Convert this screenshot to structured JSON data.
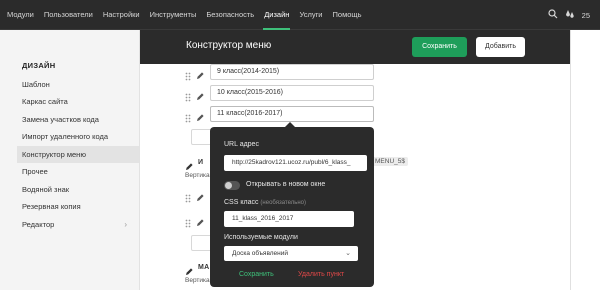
{
  "nav": {
    "items": [
      "Модули",
      "Пользователи",
      "Настройки",
      "Инструменты",
      "Безопасность",
      "Дизайн",
      "Услуги",
      "Помощь"
    ],
    "active": "Дизайн",
    "notification_count": "25"
  },
  "sidebar": {
    "section_title": "ДИЗАЙН",
    "items": [
      {
        "label": "Шаблон"
      },
      {
        "label": "Каркас сайта"
      },
      {
        "label": "Замена участков кода"
      },
      {
        "label": "Импорт удаленного кода"
      },
      {
        "label": "Конструктор меню"
      },
      {
        "label": "Прочее"
      },
      {
        "label": "Водяной знак"
      },
      {
        "label": "Резервная копия"
      },
      {
        "label": "Редактор",
        "arrow": "›"
      }
    ],
    "active": "Конструктор меню"
  },
  "header": {
    "title": "Конструктор меню",
    "save_label": "Сохранить",
    "add_label": "Добавить"
  },
  "menu_rows": [
    {
      "value": "9  класс(2014-2015)"
    },
    {
      "value": "10 класс(2015-2016)"
    },
    {
      "value": "11 класс(2016-2017)"
    }
  ],
  "block2": {
    "label_prefix": "И",
    "sub_prefix": "Вертика",
    "tag": "MENU_5$"
  },
  "block3": {
    "label_prefix": "МА",
    "sub_prefix": "Вертика"
  },
  "popover": {
    "url_label": "URL адрес",
    "url_value": "http://25kadrov121.ucoz.ru/publ/6_klass_",
    "toggle_label": "Открывать в новом окне",
    "toggle_on": false,
    "css_label": "CSS класс",
    "css_hint": "(необязательно)",
    "css_value": "11_klass_2016_2017",
    "modules_label": "Используемые модули",
    "modules_value": "Доска объявлений",
    "save_label": "Сохранить",
    "delete_label": "Удалить пункт"
  },
  "colors": {
    "dark": "#2b2b2b",
    "accent_green": "#1e9e5a",
    "danger_red": "#e04848"
  }
}
